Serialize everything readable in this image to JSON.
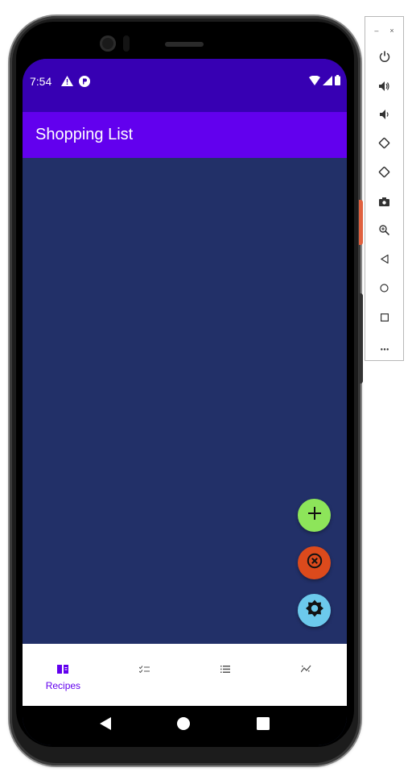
{
  "status_bar": {
    "time": "7:54",
    "icons": [
      "warning-icon",
      "p-icon",
      "wifi-icon",
      "signal-icon",
      "battery-icon"
    ]
  },
  "app_bar": {
    "title": "Shopping List"
  },
  "fabs": [
    {
      "name": "add",
      "icon": "plus-icon",
      "color": "#8de55a"
    },
    {
      "name": "cancel",
      "icon": "close-circle-icon",
      "color": "#dc4a1c"
    },
    {
      "name": "settings",
      "icon": "gear-icon",
      "color": "#6cc9ec"
    }
  ],
  "bottom_nav": {
    "items": [
      {
        "label": "Recipes",
        "icon": "book-icon",
        "selected": true
      },
      {
        "label": "",
        "icon": "checklist-icon",
        "selected": false
      },
      {
        "label": "",
        "icon": "list-icon",
        "selected": false
      },
      {
        "label": "",
        "icon": "sparkline-icon",
        "selected": false
      }
    ]
  },
  "system_nav": [
    "back-icon",
    "home-icon",
    "recents-icon"
  ],
  "emulator_panel": {
    "window_controls": {
      "minimize": "–",
      "close": "×"
    },
    "buttons": [
      "power-icon",
      "volume-up-icon",
      "volume-down-icon",
      "rotate-left-icon",
      "rotate-right-icon",
      "camera-icon",
      "zoom-icon",
      "back-icon",
      "home-icon",
      "overview-icon",
      "more-icon"
    ]
  },
  "colors": {
    "status_bar": "#3700b3",
    "app_bar": "#6200ee",
    "content_bg": "#223068",
    "accent": "#6200ee"
  }
}
